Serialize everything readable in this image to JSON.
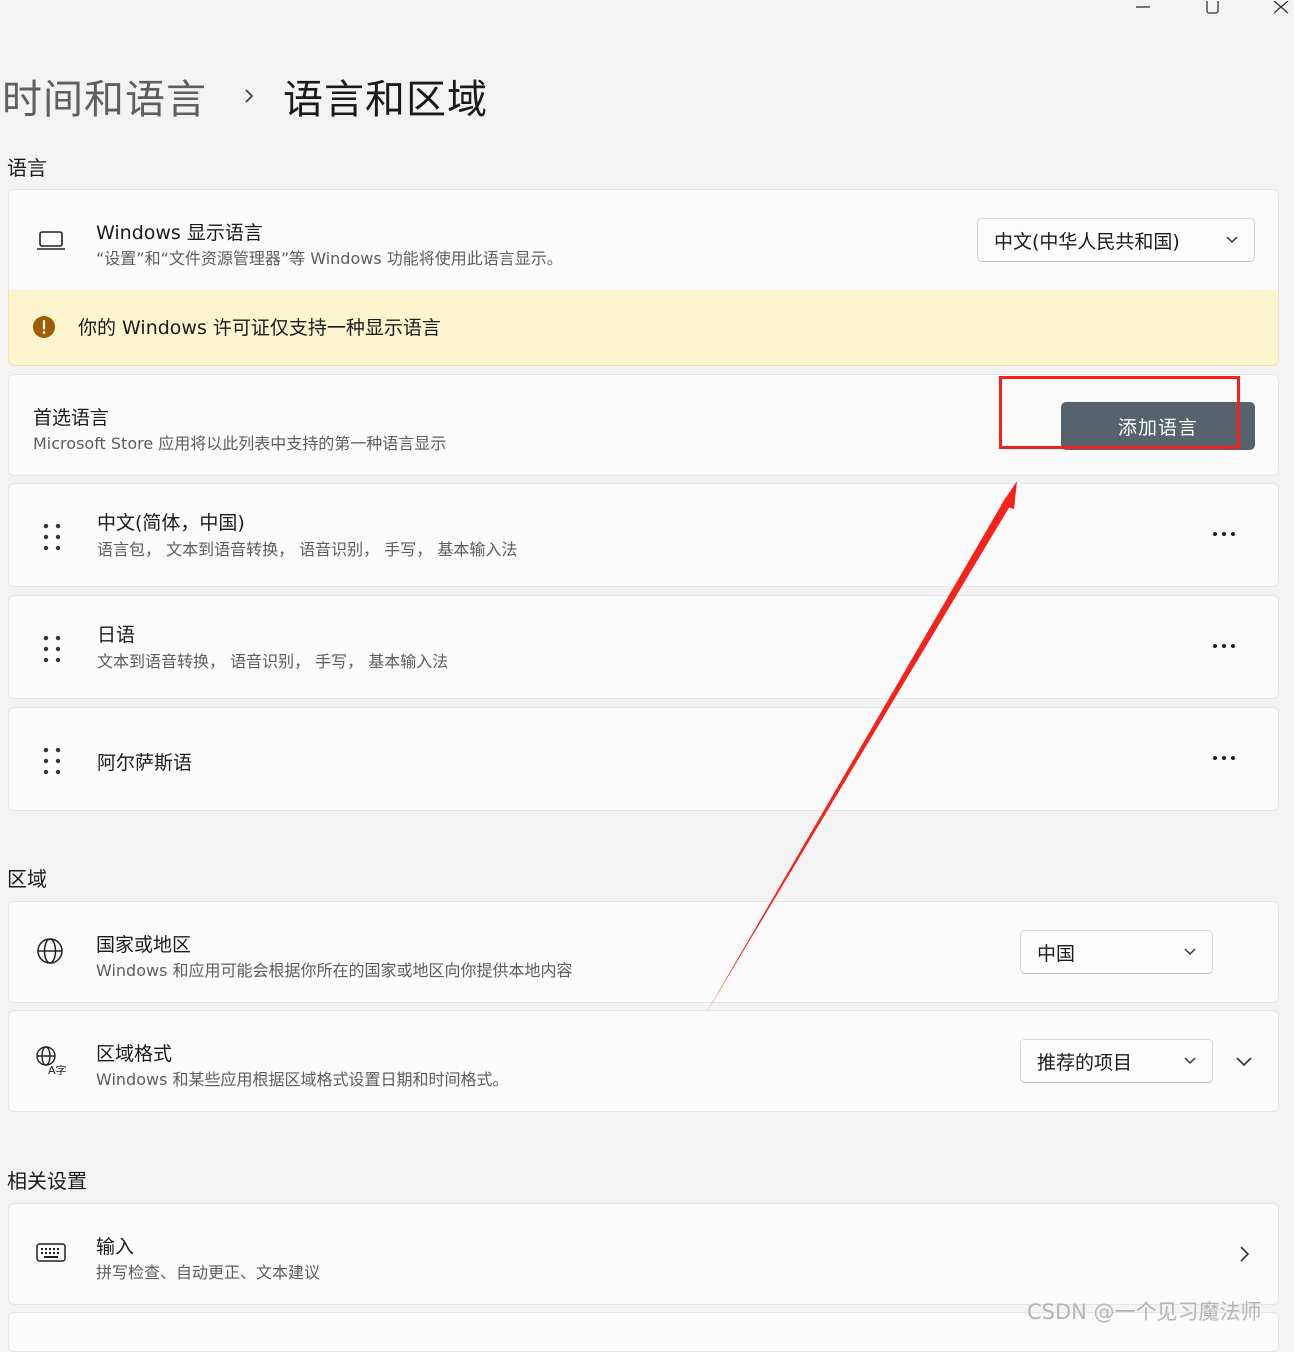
{
  "breadcrumb": {
    "parent": "时间和语言",
    "current": "语言和区域"
  },
  "sections": {
    "language": "语言",
    "region": "区域",
    "related": "相关设置"
  },
  "display_language": {
    "title": "Windows 显示语言",
    "subtitle": "“设置”和“文件资源管理器”等 Windows 功能将使用此语言显示。",
    "selected": "中文(中华人民共和国)",
    "icon": "laptop-icon"
  },
  "license_warning": {
    "text": "你的 Windows 许可证仅支持一种显示语言",
    "icon": "warning-icon",
    "color": "#9d5d00"
  },
  "preferred_languages": {
    "title": "首选语言",
    "subtitle": "Microsoft Store 应用将以此列表中支持的第一种语言显示",
    "add_button": "添加语言",
    "items": [
      {
        "name": "中文(简体，中国)",
        "features": "语言包， 文本到语音转换， 语音识别， 手写， 基本输入法"
      },
      {
        "name": "日语",
        "features": "文本到语音转换， 语音识别， 手写， 基本输入法"
      },
      {
        "name": "阿尔萨斯语",
        "features": ""
      }
    ]
  },
  "country": {
    "title": "国家或地区",
    "subtitle": "Windows 和应用可能会根据你所在的国家或地区向你提供本地内容",
    "selected": "中国",
    "icon": "globe-icon"
  },
  "regional_format": {
    "title": "区域格式",
    "subtitle": "Windows 和某些应用根据区域格式设置日期和时间格式。",
    "selected": "推荐的项目",
    "icon": "regional-format-icon"
  },
  "input": {
    "title": "输入",
    "subtitle": "拼写检查、自动更正、文本建议",
    "icon": "keyboard-icon"
  },
  "watermark": "CSDN @一个见习魔法师",
  "annotation_color": "#f5221b"
}
